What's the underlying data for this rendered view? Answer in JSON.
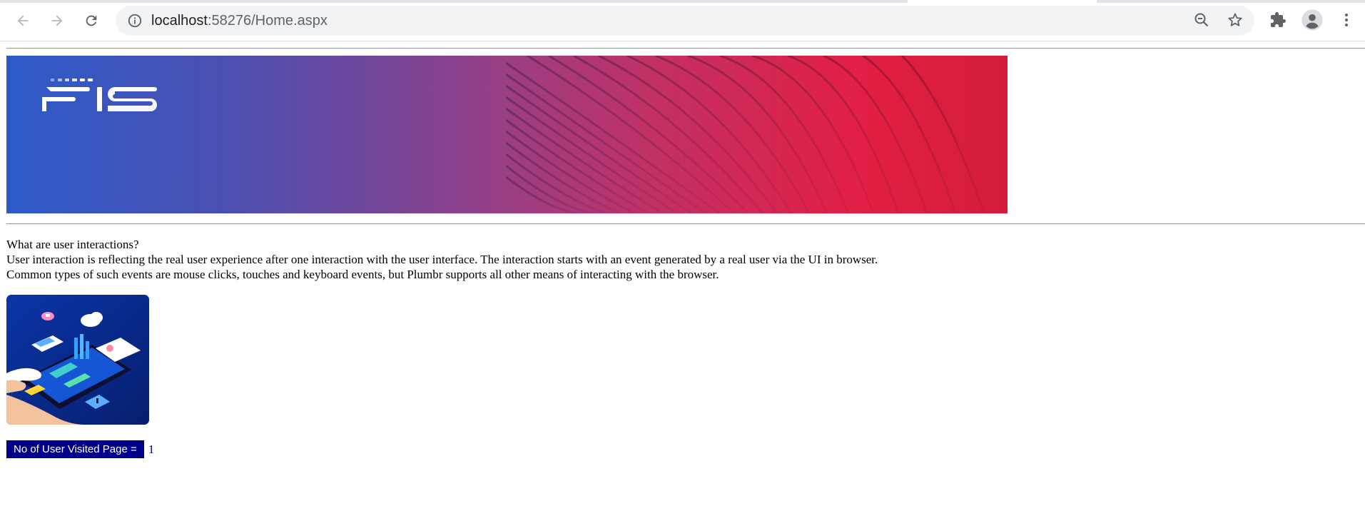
{
  "browser": {
    "url_host": "localhost",
    "url_path": ":58276/Home.aspx",
    "icons": {
      "back": "arrow-left-icon",
      "forward": "arrow-right-icon",
      "reload": "reload-icon",
      "site_info": "info-icon",
      "zoom": "zoom-out-icon",
      "bookmark": "star-icon",
      "extensions": "puzzle-icon",
      "profile": "avatar-icon",
      "menu": "kebab-menu-icon"
    }
  },
  "page": {
    "banner": {
      "logo_text": "FIS",
      "colors": {
        "left": "#2d5ac9",
        "middle": "#9a3f84",
        "right": "#e21f44"
      }
    },
    "intro": {
      "heading": "What are user interactions?",
      "line1": "User interaction is reflecting the real user experience after one interaction with the user interface. The interaction starts with an event generated by a real user via the UI in browser.",
      "line2": "Common types of such events are mouse clicks, touches and keyboard events, but Plumbr supports all other means of interacting with the browser."
    },
    "illustration": {
      "icon": "isometric-phone-interaction-icon"
    },
    "visits": {
      "label": "No of User Visited Page =",
      "count": "1",
      "label_bg": "#00008b"
    }
  }
}
